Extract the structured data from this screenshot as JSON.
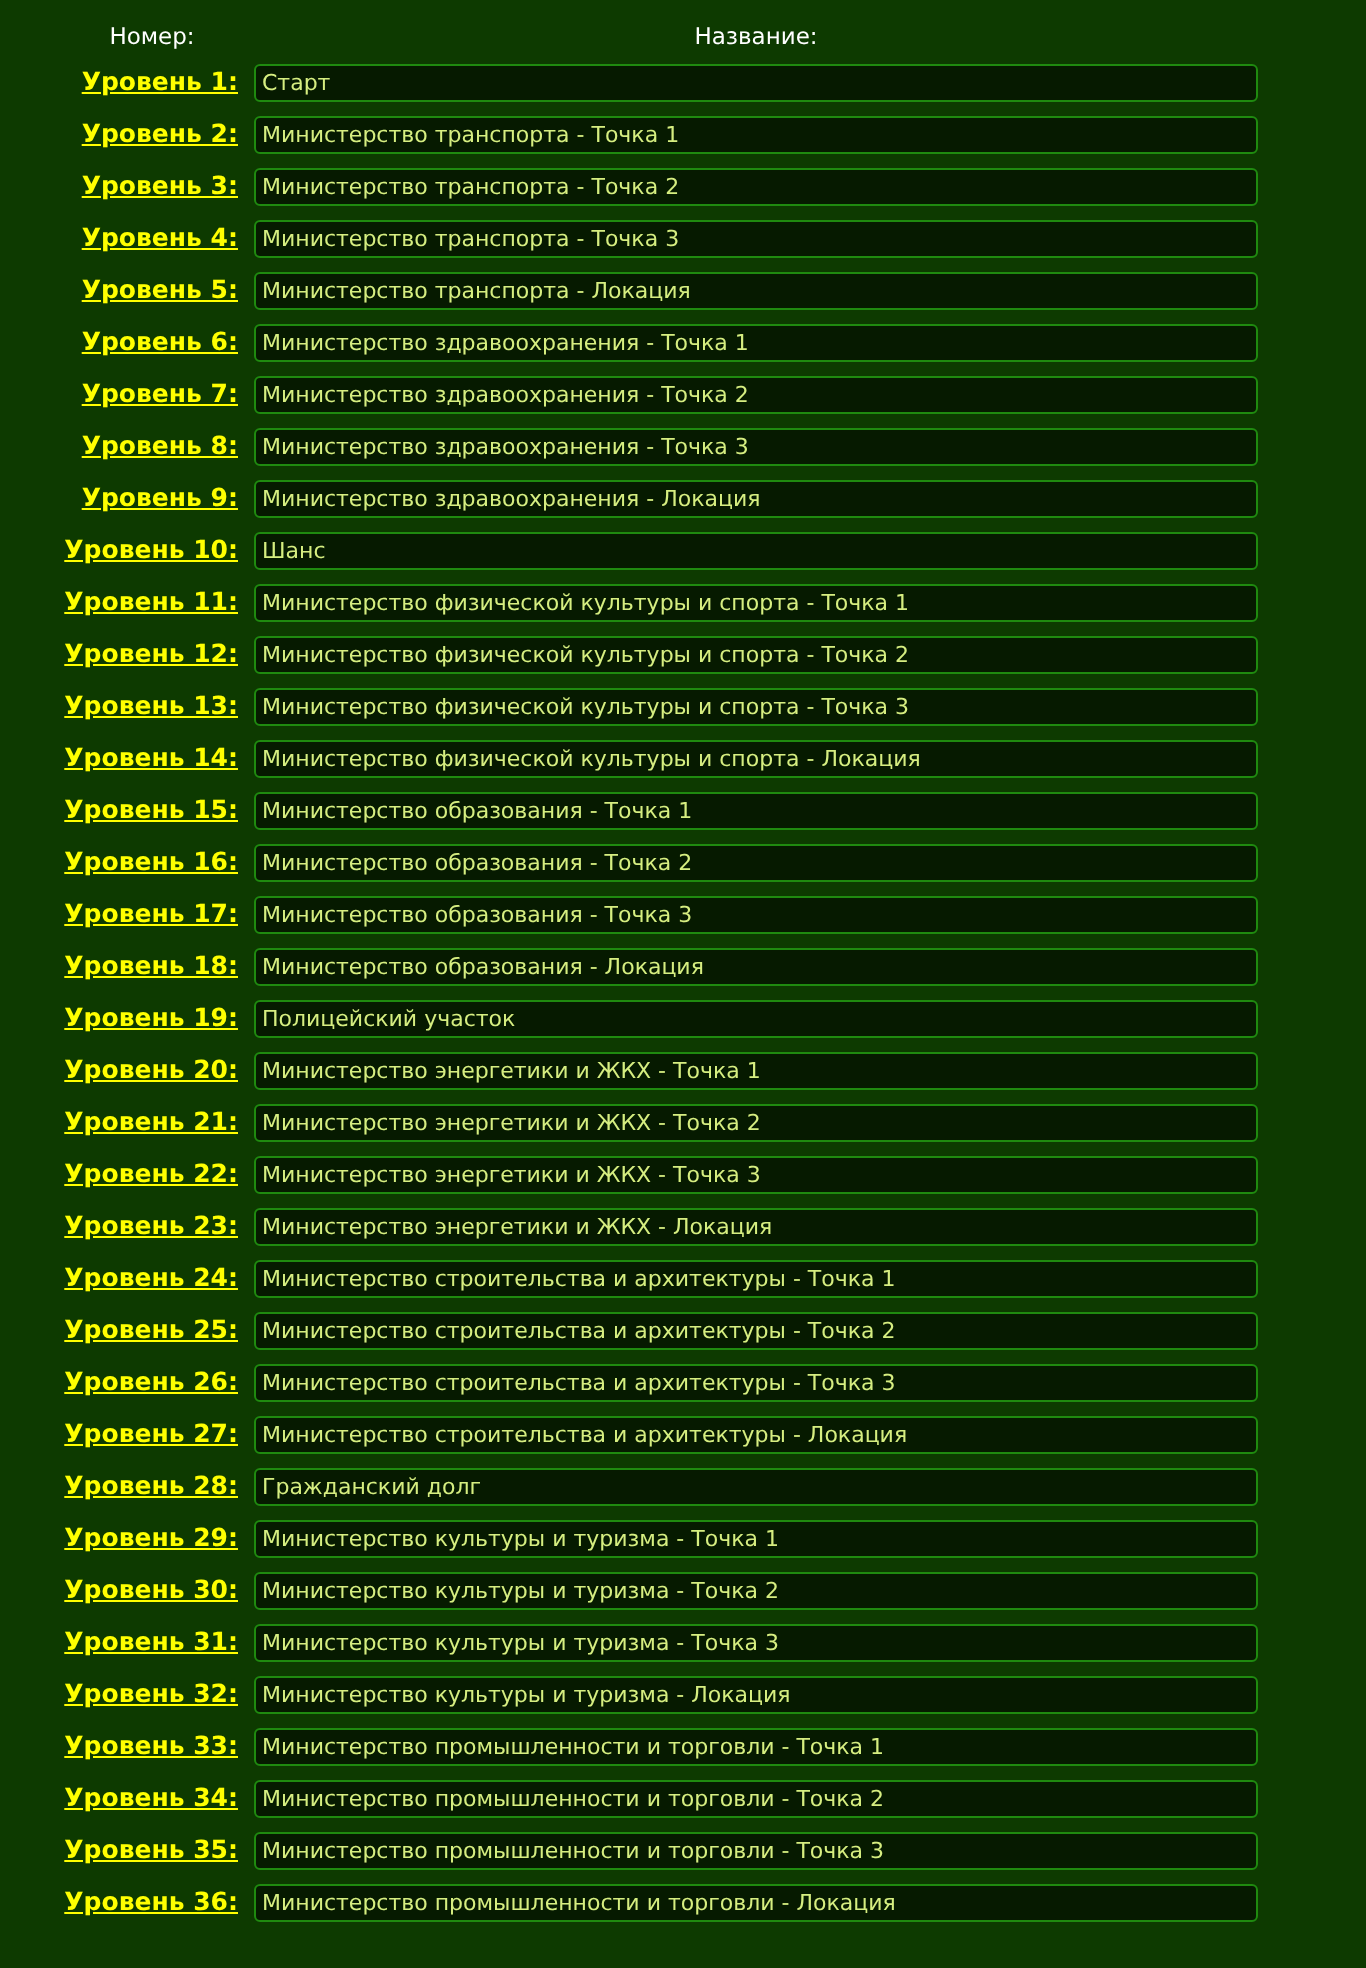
{
  "columns": [
    "Номер:",
    "Название:"
  ],
  "rows": [
    {
      "label": "Уровень 1:",
      "name": "Старт"
    },
    {
      "label": "Уровень 2:",
      "name": "Министерство транспорта - Точка 1"
    },
    {
      "label": "Уровень 3:",
      "name": "Министерство транспорта - Точка 2"
    },
    {
      "label": "Уровень 4:",
      "name": "Министерство транспорта - Точка 3"
    },
    {
      "label": "Уровень 5:",
      "name": "Министерство транспорта - Локация"
    },
    {
      "label": "Уровень 6:",
      "name": "Министерство здравоохранения - Точка 1"
    },
    {
      "label": "Уровень 7:",
      "name": "Министерство здравоохранения - Точка 2"
    },
    {
      "label": "Уровень 8:",
      "name": "Министерство здравоохранения - Точка 3"
    },
    {
      "label": "Уровень 9:",
      "name": "Министерство здравоохранения - Локация"
    },
    {
      "label": "Уровень 10:",
      "name": "Шанс"
    },
    {
      "label": "Уровень 11:",
      "name": "Министерство физической культуры и спорта - Точка 1"
    },
    {
      "label": "Уровень 12:",
      "name": "Министерство физической культуры и спорта - Точка 2"
    },
    {
      "label": "Уровень 13:",
      "name": "Министерство физической культуры и спорта - Точка 3"
    },
    {
      "label": "Уровень 14:",
      "name": "Министерство физической культуры и спорта - Локация"
    },
    {
      "label": "Уровень 15:",
      "name": "Министерство образования - Точка 1"
    },
    {
      "label": "Уровень 16:",
      "name": "Министерство образования - Точка 2"
    },
    {
      "label": "Уровень 17:",
      "name": "Министерство образования - Точка 3"
    },
    {
      "label": "Уровень 18:",
      "name": "Министерство образования - Локация"
    },
    {
      "label": "Уровень 19:",
      "name": "Полицейский участок"
    },
    {
      "label": "Уровень 20:",
      "name": "Министерство энергетики и ЖКХ - Точка 1"
    },
    {
      "label": "Уровень 21:",
      "name": "Министерство энергетики и ЖКХ - Точка 2"
    },
    {
      "label": "Уровень 22:",
      "name": "Министерство энергетики и ЖКХ - Точка 3"
    },
    {
      "label": "Уровень 23:",
      "name": "Министерство энергетики и ЖКХ - Локация"
    },
    {
      "label": "Уровень 24:",
      "name": "Министерство строительства и архитектуры - Точка 1"
    },
    {
      "label": "Уровень 25:",
      "name": "Министерство строительства и архитектуры - Точка 2"
    },
    {
      "label": "Уровень 26:",
      "name": "Министерство строительства и архитектуры - Точка 3"
    },
    {
      "label": "Уровень 27:",
      "name": "Министерство строительства и архитектуры - Локация"
    },
    {
      "label": "Уровень 28:",
      "name": "Гражданский долг"
    },
    {
      "label": "Уровень 29:",
      "name": "Министерство культуры и туризма - Точка 1"
    },
    {
      "label": "Уровень 30:",
      "name": "Министерство культуры и туризма - Точка 2"
    },
    {
      "label": "Уровень 31:",
      "name": "Министерство культуры и туризма - Точка 3"
    },
    {
      "label": "Уровень 32:",
      "name": "Министерство культуры и туризма - Локация"
    },
    {
      "label": "Уровень 33:",
      "name": "Министерство промышленности и торговли - Точка 1"
    },
    {
      "label": "Уровень 34:",
      "name": "Министерство промышленности и торговли - Точка 2"
    },
    {
      "label": "Уровень 35:",
      "name": "Министерство промышленности и торговли - Точка 3"
    },
    {
      "label": "Уровень 36:",
      "name": "Министерство промышленности и торговли - Локация"
    }
  ]
}
